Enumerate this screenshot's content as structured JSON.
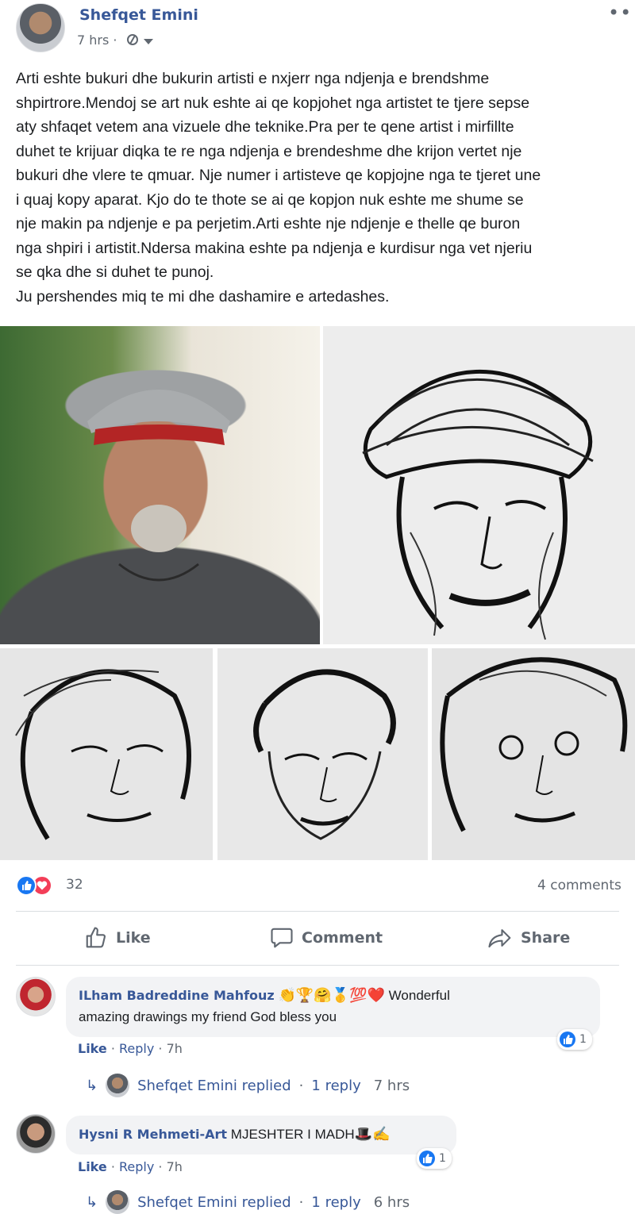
{
  "post": {
    "author": "Shefqet Emini",
    "time": "7 hrs ·",
    "more_label": "•••",
    "text_lines": [
      "Arti eshte bukuri dhe bukurin artisti e nxjerr nga ndjenja e brendshme",
      "shpirtrore.Mendoj se art nuk eshte ai qe kopjohet nga artistet te tjere sepse",
      "aty shfaqet vetem ana vizuele dhe teknike.Pra per te qene artist i mirfillte",
      "duhet te krijuar diqka te re nga ndjenja e brendeshme dhe krijon vertet nje",
      "bukuri dhe vlere te qmuar. Nje numer i artisteve qe kopjojne nga te tjeret une",
      "i quaj kopy aparat. Kjo do te thote se ai qe kopjon nuk eshte me shume se",
      "nje makin pa ndjenje e pa perjetim.Arti eshte nje ndjenje e thelle qe buron",
      "nga shpiri i artistit.Ndersa makina eshte pa ndjenja e kurdisur nga vet njeriu",
      "se qka dhe si duhet te punoj.",
      "Ju pershendes miq te mi dhe dashamire e artedashes."
    ],
    "photos": [
      "selfie-photo",
      "charcoal-sketch-man-cap",
      "charcoal-sketch-woman",
      "charcoal-sketch-man",
      "charcoal-sketch-woman-2"
    ]
  },
  "stats": {
    "reaction_count": "32",
    "comments_label": "4 comments",
    "reaction_types": [
      "like",
      "love"
    ]
  },
  "actions": {
    "like": "Like",
    "comment": "Comment",
    "share": "Share"
  },
  "comments": [
    {
      "author": "ILham Badreddine Mahfouz",
      "emojis": "👏🏆🤗🥇💯❤️",
      "text_after": " Wonderful",
      "text_line2": "amazing drawings my friend God bless you",
      "like": "Like",
      "reply": "Reply",
      "time": "7h",
      "reaction_count": "1",
      "reply_summary": {
        "name": "Shefqet Emini replied",
        "count": "1 reply",
        "time": "7 hrs"
      }
    },
    {
      "author": "Hysni R Mehmeti-Art",
      "text": " MJESHTER I MADH",
      "emojis": "🎩✍",
      "like": "Like",
      "reply": "Reply",
      "time": "7h",
      "reaction_count": "1",
      "reply_summary": {
        "name": "Shefqet Emini replied",
        "count": "1 reply",
        "time": "6 hrs"
      }
    }
  ],
  "colors": {
    "link_blue": "#385898",
    "like_blue": "#1877f2",
    "love_red": "#f33e58",
    "secondary_gray": "#606770",
    "bubble_gray": "#f2f3f5"
  }
}
